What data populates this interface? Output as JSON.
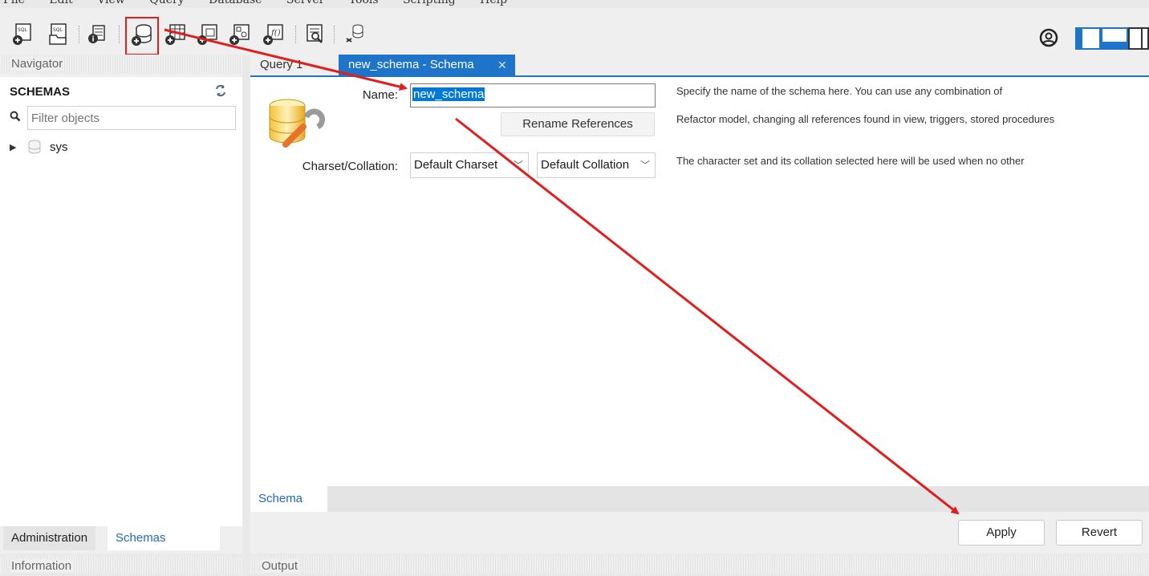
{
  "menu": [
    "File",
    "Edit",
    "View",
    "Query",
    "Database",
    "Server",
    "Tools",
    "Scripting",
    "Help"
  ],
  "toolbar": {
    "icons": [
      "new-sql-tab-icon",
      "open-sql-script-icon",
      "schema-inspector-icon",
      "create-schema-icon",
      "create-table-icon",
      "create-view-icon",
      "create-procedure-icon",
      "create-function-icon",
      "search-table-data-icon",
      "reconnect-icon"
    ],
    "highlighted": "create-schema-icon",
    "right_icons": [
      "settings-icon",
      "toggle-sidebar-icon",
      "toggle-output-icon",
      "toggle-secondary-sidebar-icon"
    ]
  },
  "navigator": {
    "header": "Navigator",
    "schemas_title": "SCHEMAS",
    "filter_placeholder": "Filter objects",
    "tree": [
      {
        "label": "sys",
        "expanded": false
      }
    ],
    "tabs": {
      "administration": "Administration",
      "schemas": "Schemas"
    }
  },
  "information": {
    "header": "Information"
  },
  "output": {
    "header": "Output"
  },
  "tabs": {
    "query": "Query 1",
    "active": "new_schema - Schema"
  },
  "schema_editor": {
    "name_label": "Name:",
    "name_value": "new_schema",
    "rename_button": "Rename References",
    "charset_label": "Charset/Collation:",
    "charset_value": "Default Charset",
    "collation_value": "Default Collation",
    "help_name": "Specify the name of the schema here. You can use any combination of",
    "help_rename": "Refactor model, changing all references found in view, triggers, stored procedures",
    "help_charset": "The character set and its collation selected here will be used when no other"
  },
  "subtabs": {
    "schema": "Schema"
  },
  "footer": {
    "apply": "Apply",
    "revert": "Revert"
  },
  "colors": {
    "accent": "#1e74c8",
    "annotation": "#e01e1e",
    "selection": "#0078d7"
  }
}
